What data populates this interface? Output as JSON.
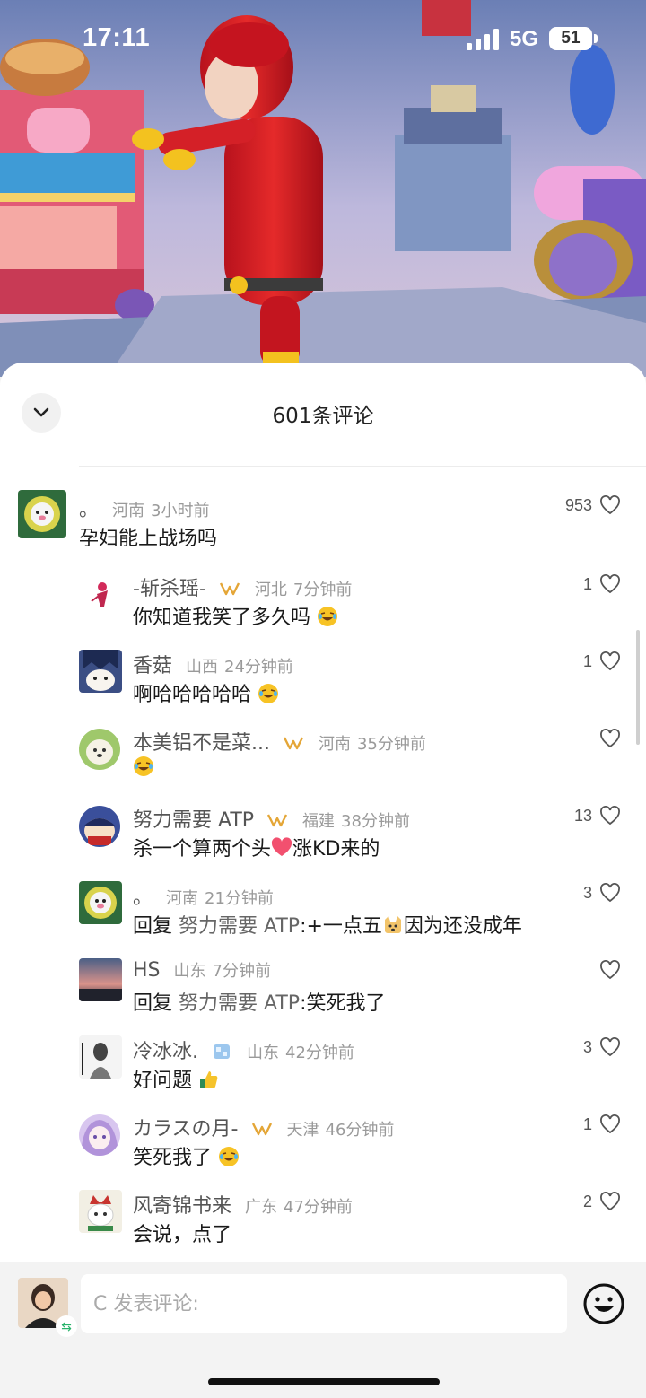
{
  "status_bar": {
    "time": "17:11",
    "network": "5G",
    "battery": "51"
  },
  "sheet": {
    "title": "601条评论"
  },
  "comments": [
    {
      "user": "。",
      "location": "河南",
      "time": "3小时前",
      "text": "孕妇能上战场吗",
      "likes": "953",
      "avatar_icon": "cartoon-avatar"
    },
    {
      "user": "-斩杀瑶-",
      "location": "河北",
      "time": "7分钟前",
      "text": "你知道我笑了多久吗",
      "likes": "1",
      "badge": true,
      "emoji": "laugh-cry-emoji"
    },
    {
      "user": "香菇",
      "location": "山西",
      "time": "24分钟前",
      "text": "啊哈哈哈哈哈",
      "likes": "1",
      "emoji": "laugh-cry-emoji"
    },
    {
      "user": "本美铝不是菜...",
      "location": "河南",
      "time": "35分钟前",
      "text": "",
      "likes": "",
      "badge": true,
      "emoji": "laugh-cry-emoji"
    },
    {
      "user": "努力需要 ATP",
      "location": "福建",
      "time": "38分钟前",
      "text_pre": "杀一个算两个头",
      "text_post": "涨KD来的",
      "likes": "13",
      "badge": true,
      "emoji": "heart-emoji"
    },
    {
      "user": "。",
      "location": "河南",
      "time": "21分钟前",
      "reply_label": "回复",
      "reply_target": "努力需要 ATP",
      "text_pre": ":+一点五",
      "text_post": "因为还没成年",
      "likes": "3",
      "emoji": "doge-emoji"
    },
    {
      "user": "HS",
      "location": "山东",
      "time": "7分钟前",
      "reply_label": "回复",
      "reply_target": "努力需要 ATP",
      "text": ":笑死我了",
      "likes": ""
    },
    {
      "user": "冷冰冰.",
      "location": "山东",
      "time": "42分钟前",
      "text": "好问题",
      "likes": "3",
      "emoji": "thumbs-up-emoji"
    },
    {
      "user": "カラスの月-",
      "location": "天津",
      "time": "46分钟前",
      "text": "笑死我了",
      "likes": "1",
      "badge": true,
      "emoji": "laugh-cry-emoji"
    },
    {
      "user": "风寄锦书来",
      "location": "广东",
      "time": "47分钟前",
      "text": "会说，点了",
      "likes": "2"
    }
  ],
  "input": {
    "placeholder": "C 发表评论:"
  },
  "colors": {
    "sheet_bg": "#ffffff",
    "heart_outline": "#555555",
    "badge_gold": "#e4a637",
    "input_bar_bg": "#f3f3f3"
  }
}
